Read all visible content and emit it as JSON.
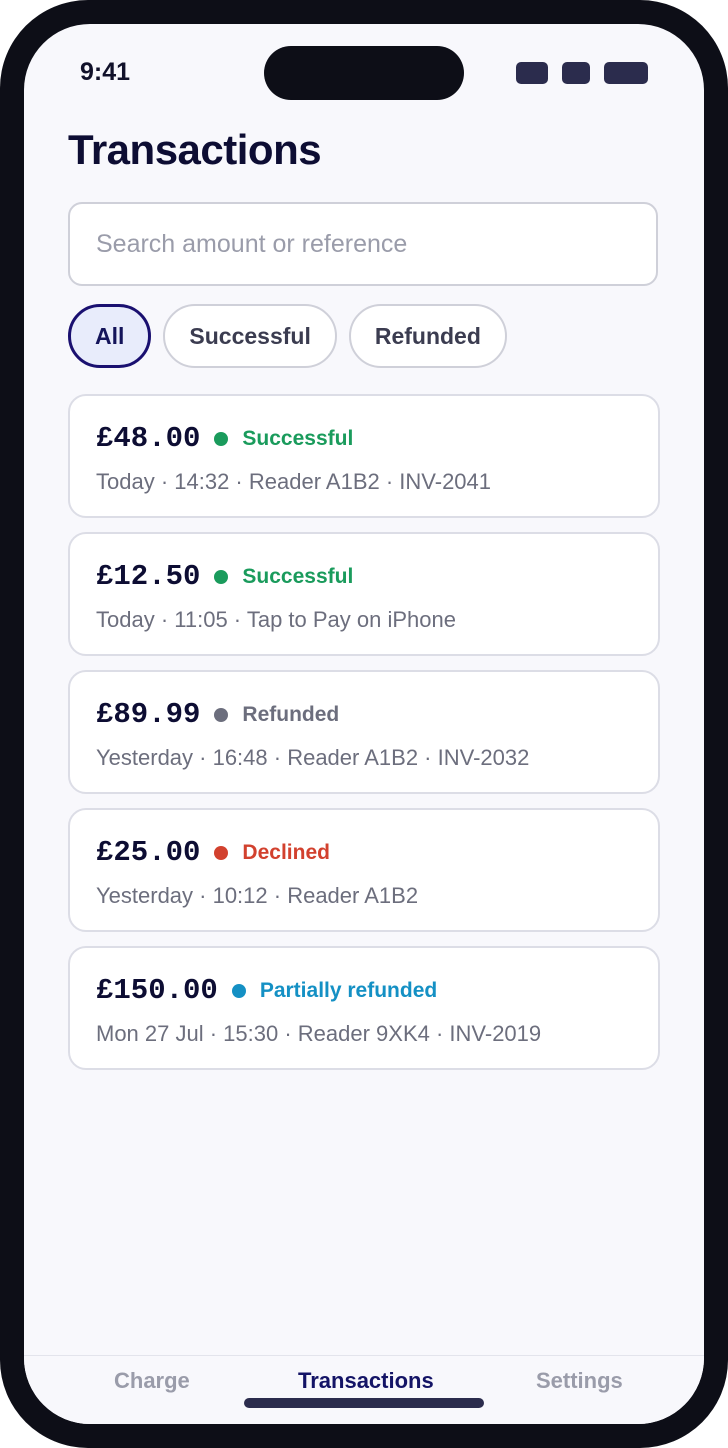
{
  "status_bar": {
    "time": "9:41",
    "icons": [
      "signal-icon",
      "wifi-icon",
      "battery-icon"
    ]
  },
  "header": {
    "title": "Transactions"
  },
  "search": {
    "placeholder": "Search amount or reference",
    "value": ""
  },
  "filters": [
    {
      "label": "All",
      "active": true
    },
    {
      "label": "Successful",
      "active": false
    },
    {
      "label": "Refunded",
      "active": false
    }
  ],
  "transactions": [
    {
      "amount": "£48.00",
      "status": "Successful",
      "status_color": "#1a9b5c",
      "meta": "Today · 14:32 · Reader A1B2 · INV-2041"
    },
    {
      "amount": "£12.50",
      "status": "Successful",
      "status_color": "#1a9b5c",
      "meta": "Today · 11:05 · Tap to Pay on iPhone"
    },
    {
      "amount": "£89.99",
      "status": "Refunded",
      "status_color": "#6c6e7d",
      "meta": "Yesterday · 16:48 · Reader A1B2 · INV-2032"
    },
    {
      "amount": "£25.00",
      "status": "Declined",
      "status_color": "#d2412e",
      "meta": "Yesterday · 10:12 · Reader A1B2"
    },
    {
      "amount": "£150.00",
      "status": "Partially refunded",
      "status_color": "#1490c4",
      "meta": "Mon 27 Jul · 15:30 · Reader 9XK4 · INV-2019"
    }
  ],
  "tabbar": {
    "tabs": [
      {
        "label": "Charge",
        "active": false
      },
      {
        "label": "Transactions",
        "active": true
      },
      {
        "label": "Settings",
        "active": false
      }
    ]
  },
  "colors": {
    "accent": "#1a1070",
    "background": "#f8f8fc",
    "frame": "#0d0e17"
  }
}
